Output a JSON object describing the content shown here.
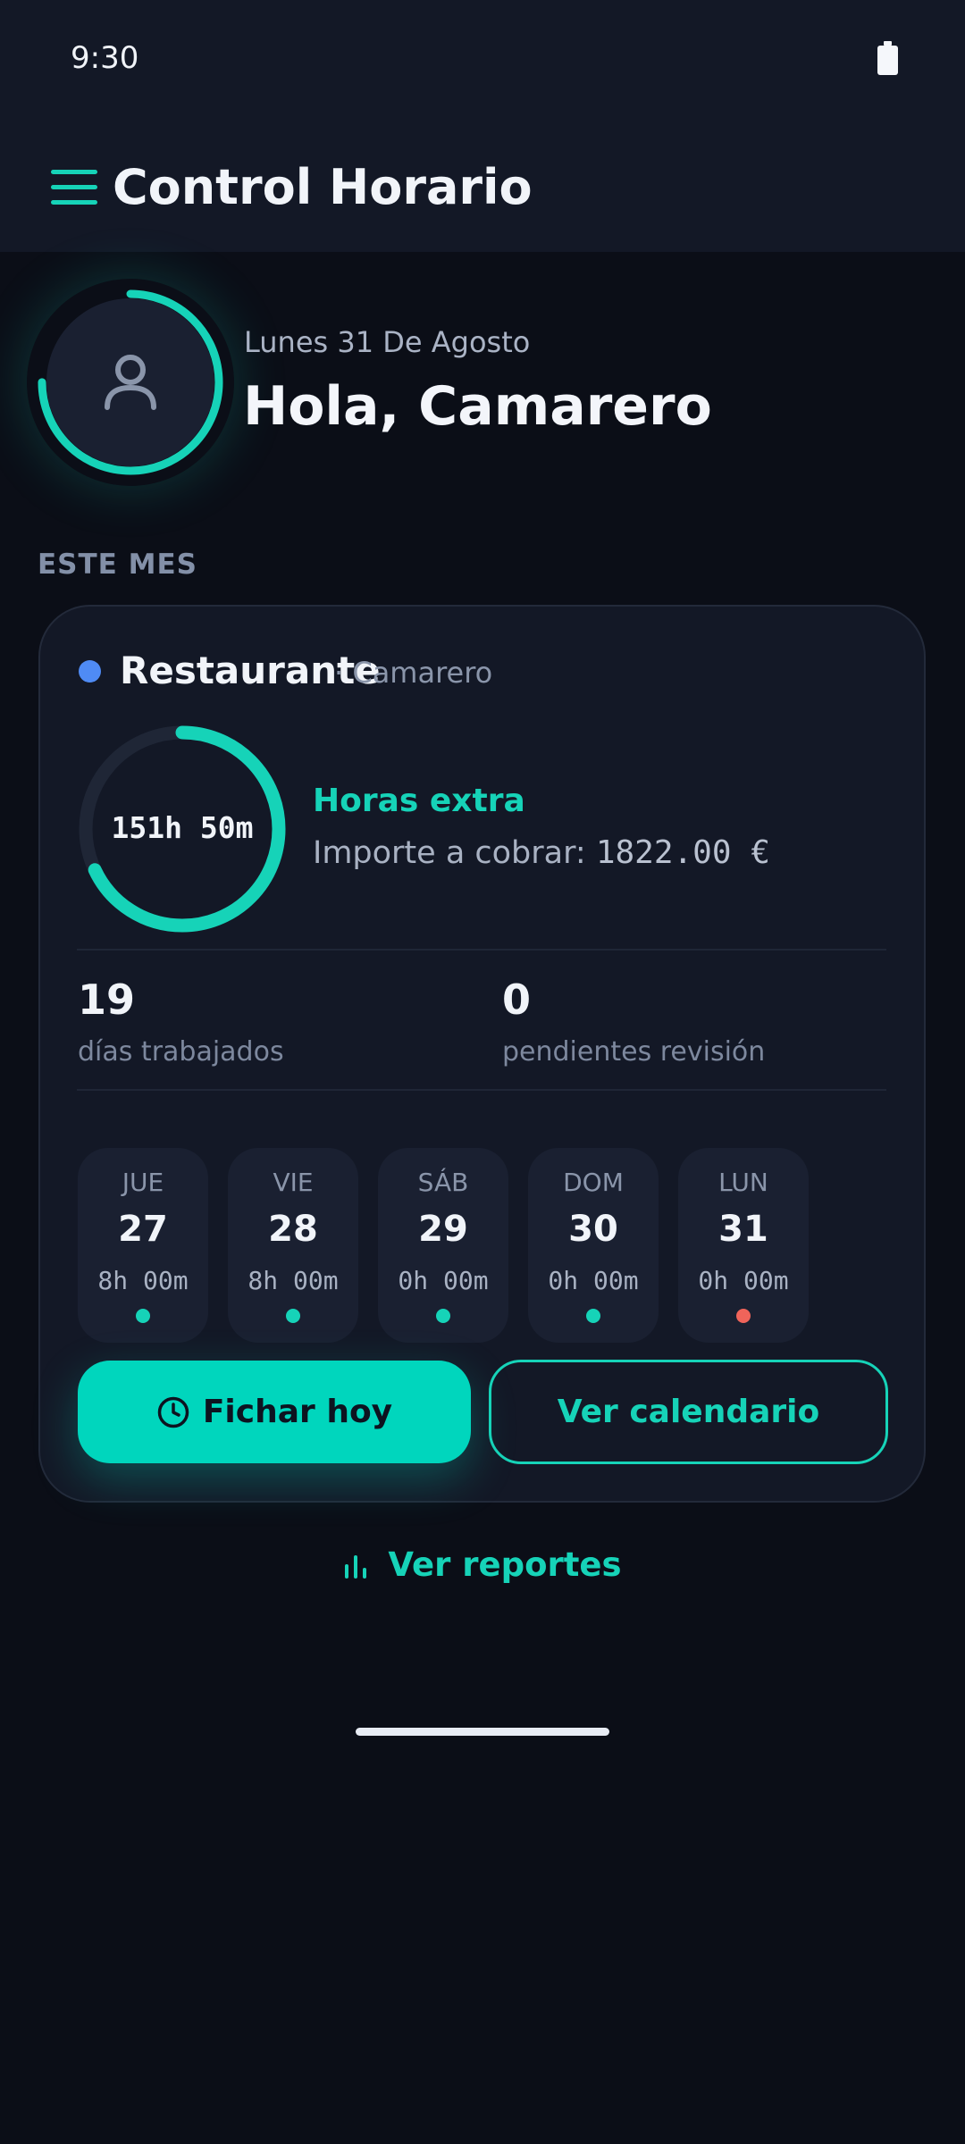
{
  "status_bar": {
    "time": "9:30"
  },
  "app_bar": {
    "title": "Control Horario"
  },
  "greeting": {
    "date": "Lunes 31 De Agosto",
    "hello": "Hola, Camarero",
    "avatar_progress": 0.75
  },
  "section": {
    "label": "ESTE MES"
  },
  "card": {
    "company": "Restaurante",
    "role": "· Camarero",
    "total_hours": "151h 50m",
    "hours_progress": 0.68,
    "extra_title": "Horas extra",
    "amount_label": "Importe a cobrar:",
    "amount_value": "1822.00 €",
    "stats": [
      {
        "value": "19",
        "label": "días trabajados"
      },
      {
        "value": "0",
        "label": "pendientes revisión"
      }
    ],
    "days": [
      {
        "name": "JUE",
        "date": "27",
        "hours": "8h 00m",
        "status_color": "#16d3b8"
      },
      {
        "name": "VIE",
        "date": "28",
        "hours": "8h 00m",
        "status_color": "#16d3b8"
      },
      {
        "name": "SÁB",
        "date": "29",
        "hours": "0h 00m",
        "status_color": "#16d3b8"
      },
      {
        "name": "DOM",
        "date": "30",
        "hours": "0h 00m",
        "status_color": "#16d3b8"
      },
      {
        "name": "LUN",
        "date": "31",
        "hours": "0h 00m",
        "status_color": "#f0645a"
      }
    ],
    "primary_button": "Fichar hoy",
    "secondary_button": "Ver calendario"
  },
  "reports_link": "Ver reportes",
  "colors": {
    "accent": "#16d3b8",
    "background": "#0b0e17",
    "surface": "#131826",
    "company_dot": "#4f8bf5"
  },
  "icons": {
    "menu": "hamburger-icon",
    "avatar": "person-icon",
    "clock": "clock-icon",
    "reports": "bar-chart-icon",
    "battery": "battery-icon"
  }
}
